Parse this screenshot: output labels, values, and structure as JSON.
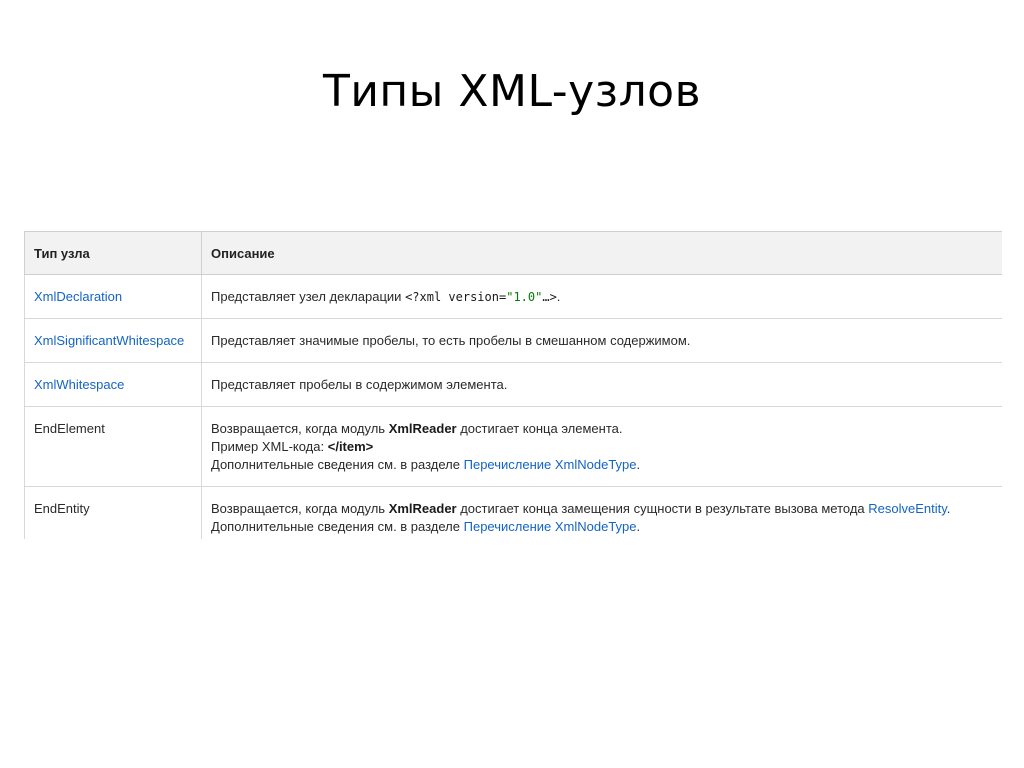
{
  "slide": {
    "title": "Типы XML-узлов"
  },
  "table": {
    "headers": {
      "type": "Тип узла",
      "description": "Описание"
    },
    "rows": [
      {
        "type": "XmlDeclaration",
        "type_is_link": true,
        "desc_prefix": "Представляет узел декларации ",
        "code_a": "<?xml version=",
        "code_str": "\"1.0\"",
        "code_b": "…>",
        "desc_suffix": "."
      },
      {
        "type": "XmlSignificantWhitespace",
        "type_is_link": true,
        "desc": "Представляет значимые пробелы, то есть пробелы в смешанном содержимом."
      },
      {
        "type": "XmlWhitespace",
        "type_is_link": true,
        "desc": "Представляет пробелы в содержимом элемента."
      },
      {
        "type": "EndElement",
        "type_is_link": false,
        "l1_a": "Возвращается, когда модуль ",
        "l1_b": "XmlReader",
        "l1_c": " достигает конца элемента.",
        "l2_a": "Пример XML-кода: ",
        "l2_b": "</item>",
        "l3_a": "Дополнительные сведения см. в разделе ",
        "l3_link": "Перечисление XmlNodeType",
        "l3_c": "."
      },
      {
        "type": "EndEntity",
        "type_is_link": false,
        "l1_a": "Возвращается, когда модуль ",
        "l1_b": "XmlReader",
        "l1_c": " достигает конца замещения сущности в результате вызова метода ",
        "l1_link": "ResolveEntity",
        "l1_d": ".",
        "l2_a": "Дополнительные сведения см. в разделе ",
        "l2_link": "Перечисление XmlNodeType",
        "l2_c": "."
      }
    ]
  },
  "colors": {
    "link": "#1364c4",
    "code_string": "#008000",
    "header_bg": "#f2f2f2"
  }
}
